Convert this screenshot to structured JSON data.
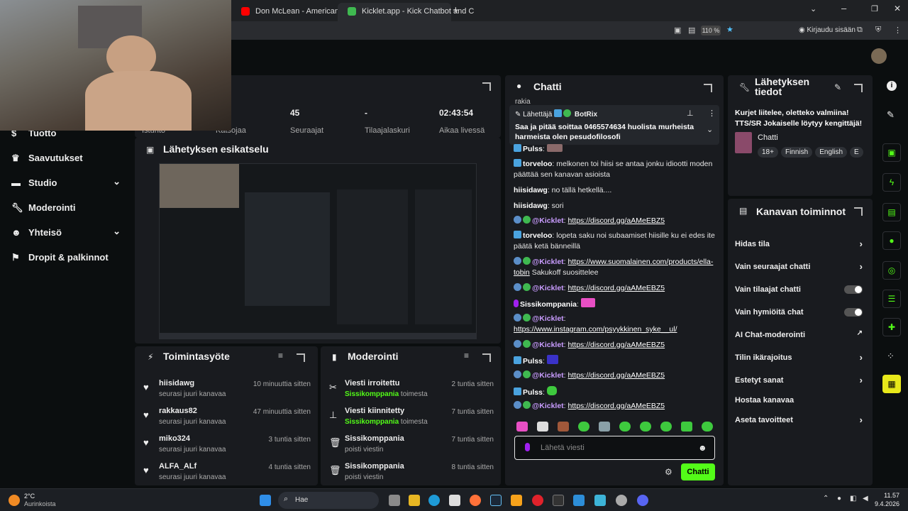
{
  "browser": {
    "tabs": [
      {
        "title": "Don McLean - American Pie (Ly",
        "color": "#ff0000"
      },
      {
        "title": "Kicklet.app - Kick Chatbot and C",
        "color": "#3fb950"
      }
    ],
    "zoom": "110 %",
    "login": "Kirjaudu sisään"
  },
  "sidebar": {
    "items": [
      {
        "label": "Tuotto",
        "icon": "money-icon"
      },
      {
        "label": "Saavutukset",
        "icon": "trophy-icon"
      },
      {
        "label": "Studio",
        "icon": "studio-icon"
      },
      {
        "label": "Moderointi",
        "icon": "wrench-icon"
      },
      {
        "label": "Yhteisö",
        "icon": "users-icon"
      },
      {
        "label": "Dropit & palkinnot",
        "icon": "gift-icon"
      }
    ]
  },
  "stats": [
    {
      "value": "",
      "label": "Istunto"
    },
    {
      "value": "",
      "label": "Katsojaa"
    },
    {
      "value": "45",
      "label": "Seuraajat"
    },
    {
      "value": "-",
      "label": "Tilaajalaskuri"
    },
    {
      "value": "02:43:54",
      "label": "Aikaa livessä"
    }
  ],
  "preview": {
    "title": "Lähetyksen esikatselu"
  },
  "activity": {
    "title": "Toimintasyöte",
    "rows": [
      {
        "name": "hiisidawg",
        "sub": "seurasi juuri kanavaa",
        "time": "10 minuuttia sitten"
      },
      {
        "name": "rakkaus82",
        "sub": "seurasi juuri kanavaa",
        "time": "47 minuuttia sitten"
      },
      {
        "name": "miko324",
        "sub": "seurasi juuri kanavaa",
        "time": "3 tuntia sitten"
      },
      {
        "name": "ALFA_ALf",
        "sub": "seurasi juuri kanavaa",
        "time": "4 tuntia sitten"
      }
    ]
  },
  "moderation": {
    "title": "Moderointi",
    "rows": [
      {
        "title": "Viesti irroitettu",
        "user": "Sissikomppania",
        "rest": " toimesta",
        "time": "2 tuntia sitten",
        "icon": "unpin-icon"
      },
      {
        "title": "Viesti kiinnitetty",
        "user": "Sissikomppania",
        "rest": " toimesta",
        "time": "7 tuntia sitten",
        "icon": "pin-icon"
      },
      {
        "title": "Sissikomppania",
        "user": "",
        "rest": "poisti viestin",
        "time": "7 tuntia sitten",
        "icon": "trash-icon"
      },
      {
        "title": "Sissikomppania",
        "user": "",
        "rest": "poisti viestin",
        "time": "8 tuntia sitten",
        "icon": "trash-icon"
      }
    ]
  },
  "chat": {
    "title": "Chatti",
    "top_cut": "rakia",
    "pinned": {
      "sender_label": "Lähettäjä",
      "sender": "BotRix",
      "text": "Saa ja pitää soittaa 0465574634 huolista murheista harmeista olen pesudofilosofi"
    },
    "messages": [
      {
        "user": "Pulss",
        "text": ":",
        "link": ""
      },
      {
        "user": "torveloo",
        "text": ": melkonen toi hiisi se antaa jonku idiootti moden päättää sen kanavan asioista",
        "link": ""
      },
      {
        "user": "hiisidawg",
        "text": ": no tällä hetkellä....",
        "link": ""
      },
      {
        "user": "hiisidawg",
        "text": ": sori",
        "link": ""
      },
      {
        "user": "@Kicklet",
        "text": ": ",
        "link": "https://discord.gg/aAMeEBZ5"
      },
      {
        "user": "torveloo",
        "text": ": lopeta saku noi subaamiset hiisille ku ei edes ite päätä ketä bänneillä",
        "link": ""
      },
      {
        "user": "@Kicklet",
        "text": ": ",
        "link": "https://www.suomalainen.com/products/ella-tobin",
        "after": " Sakukoff suosittelee"
      },
      {
        "user": "@Kicklet",
        "text": ": ",
        "link": "https://discord.gg/aAMeEBZ5"
      },
      {
        "user": "Sissikomppania",
        "text": ":",
        "link": ""
      },
      {
        "user": "@Kicklet",
        "text": ": ",
        "link": "https://www.instagram.com/psyykkinen_syke__ul/"
      },
      {
        "user": "@Kicklet",
        "text": ": ",
        "link": "https://discord.gg/aAMeEBZ5"
      },
      {
        "user": "Pulss",
        "text": ":",
        "link": ""
      },
      {
        "user": "@Kicklet",
        "text": ": ",
        "link": "https://discord.gg/aAMeEBZ5"
      },
      {
        "user": "Pulss",
        "text": ":",
        "link": ""
      },
      {
        "user": "@Kicklet",
        "text": ": ",
        "link": "https://discord.gg/aAMeEBZ5"
      }
    ],
    "input_placeholder": "Lähetä viesti",
    "send_label": "Chatti"
  },
  "stream_info": {
    "title": "Lähetyksen tiedot",
    "stream_title": "Kurjet liitelee, oletteko valmiina! TTS/SR Jokaiselle löytyy kengittäjä!",
    "category": "Chatti",
    "tags": [
      "18+",
      "Finnish",
      "English",
      "E"
    ]
  },
  "channel_actions": {
    "title": "Kanavan toiminnot",
    "items": [
      {
        "label": "Hidas tila",
        "control": "chevron"
      },
      {
        "label": "Vain seuraajat chatti",
        "control": "chevron"
      },
      {
        "label": "Vain tilaajat chatti",
        "control": "toggle"
      },
      {
        "label": "Vain hymiöitä chat",
        "control": "toggle"
      },
      {
        "label": "AI Chat-moderointi",
        "control": "external"
      },
      {
        "label": "Tilin ikärajoitus",
        "control": "chevron"
      },
      {
        "label": "Estetyt sanat",
        "control": "chevron"
      },
      {
        "label": "Hostaa kanavaa",
        "control": "none"
      },
      {
        "label": "Aseta tavoitteet",
        "control": "chevron"
      }
    ]
  },
  "taskbar": {
    "weather_temp": "2°C",
    "weather_desc": "Aurinkoista",
    "search": "Hae",
    "time": "11.57",
    "date": "9.4.2026"
  }
}
